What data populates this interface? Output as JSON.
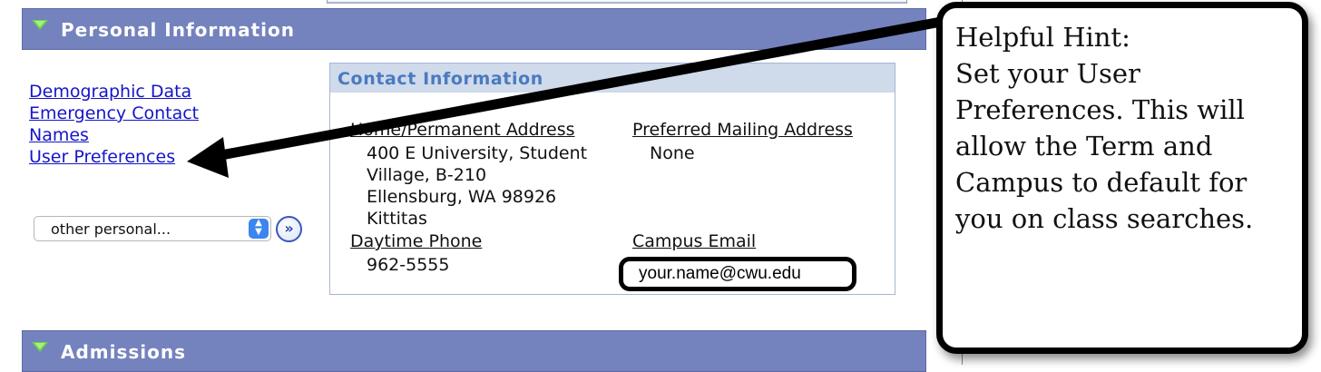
{
  "sections": {
    "personal_information": "Personal Information",
    "admissions": "Admissions"
  },
  "nav_links": [
    "Demographic Data",
    "Emergency Contact",
    "Names",
    "User Preferences"
  ],
  "other_select": {
    "selected": "other personal..."
  },
  "contact": {
    "title": "Contact Information",
    "home_address_label": "Home/Permanent Address",
    "home_address_lines": [
      "400 E University, Student",
      "Village, B-210",
      "Ellensburg, WA 98926",
      "Kittitas"
    ],
    "preferred_mailing_label": "Preferred Mailing Address",
    "preferred_mailing_value": "None",
    "daytime_phone_label": "Daytime Phone",
    "daytime_phone_value": "962-5555",
    "campus_email_label": "Campus Email",
    "campus_email_value": "your.name@cwu.edu"
  },
  "hint": {
    "lines": [
      "Helpful Hint:",
      "Set your User",
      "Preferences. This will",
      "allow the Term and",
      "Campus to default for",
      "you on class searches."
    ]
  },
  "colors": {
    "section_bar": "#7483be",
    "link": "#1515c8",
    "contact_header_bg": "#cfdaeb",
    "contact_header_text": "#4a7ac0"
  }
}
